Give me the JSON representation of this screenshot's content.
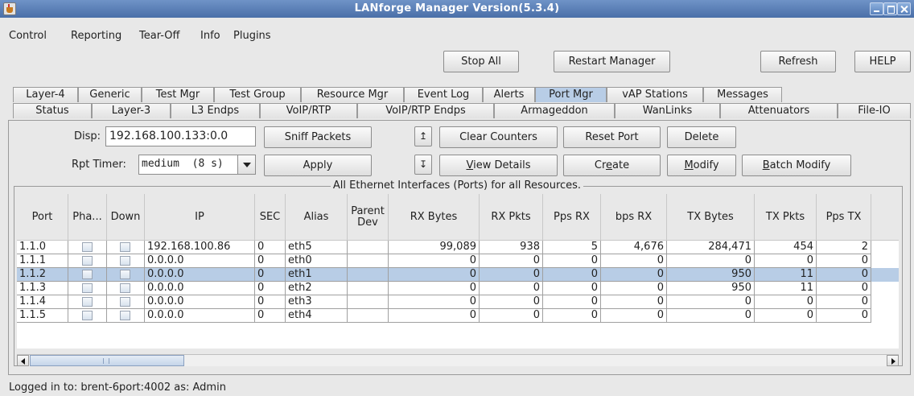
{
  "window": {
    "title": "LANforge Manager   Version(5.3.4)"
  },
  "menu": [
    "Control",
    "Reporting",
    "Tear-Off",
    "Info",
    "Plugins"
  ],
  "toolbar": {
    "stop_all": "Stop All",
    "restart_manager": "Restart Manager",
    "refresh": "Refresh",
    "help": "HELP"
  },
  "tabs_row1": [
    "Layer-4",
    "Generic",
    "Test Mgr",
    "Test Group",
    "Resource Mgr",
    "Event Log",
    "Alerts",
    "Port Mgr",
    "vAP Stations",
    "Messages"
  ],
  "tabs_row2": [
    "Status",
    "Layer-3",
    "L3 Endps",
    "VoIP/RTP",
    "VoIP/RTP Endps",
    "Armageddon",
    "WanLinks",
    "Attenuators",
    "File-IO"
  ],
  "active_tab": "Port Mgr",
  "controls": {
    "disp_label": "Disp:",
    "disp_value": "192.168.100.133:0.0",
    "rpt_label": "Rpt Timer:",
    "rpt_value": "medium  (8 s)",
    "sniff_packets": "Sniff Packets",
    "apply": "Apply",
    "sort_up": "↥",
    "sort_down": "↧",
    "clear_counters": "Clear Counters",
    "view_details": "View Details",
    "reset_port": "Reset Port",
    "create": "Create",
    "delete": "Delete",
    "modify": "Modify",
    "batch_modify": "Batch Modify"
  },
  "table": {
    "title": "All Ethernet Interfaces (Ports) for all Resources.",
    "columns": [
      "Port",
      "Pha...",
      "Down",
      "IP",
      "SEC",
      "Alias",
      "Parent Dev",
      "RX Bytes",
      "RX Pkts",
      "Pps RX",
      "bps RX",
      "TX Bytes",
      "TX Pkts",
      "Pps TX"
    ],
    "rows": [
      {
        "port": "1.1.0",
        "ip": "192.168.100.86",
        "sec": "0",
        "alias": "eth5",
        "rx_bytes": "99,089",
        "rx_pkts": "938",
        "pps_rx": "5",
        "bps_rx": "4,676",
        "tx_bytes": "284,471",
        "tx_pkts": "454",
        "pps_tx": "2",
        "selected": false
      },
      {
        "port": "1.1.1",
        "ip": "0.0.0.0",
        "sec": "0",
        "alias": "eth0",
        "rx_bytes": "0",
        "rx_pkts": "0",
        "pps_rx": "0",
        "bps_rx": "0",
        "tx_bytes": "0",
        "tx_pkts": "0",
        "pps_tx": "0",
        "selected": false
      },
      {
        "port": "1.1.2",
        "ip": "0.0.0.0",
        "sec": "0",
        "alias": "eth1",
        "rx_bytes": "0",
        "rx_pkts": "0",
        "pps_rx": "0",
        "bps_rx": "0",
        "tx_bytes": "950",
        "tx_pkts": "11",
        "pps_tx": "0",
        "selected": true
      },
      {
        "port": "1.1.3",
        "ip": "0.0.0.0",
        "sec": "0",
        "alias": "eth2",
        "rx_bytes": "0",
        "rx_pkts": "0",
        "pps_rx": "0",
        "bps_rx": "0",
        "tx_bytes": "950",
        "tx_pkts": "11",
        "pps_tx": "0",
        "selected": false
      },
      {
        "port": "1.1.4",
        "ip": "0.0.0.0",
        "sec": "0",
        "alias": "eth3",
        "rx_bytes": "0",
        "rx_pkts": "0",
        "pps_rx": "0",
        "bps_rx": "0",
        "tx_bytes": "0",
        "tx_pkts": "0",
        "pps_tx": "0",
        "selected": false
      },
      {
        "port": "1.1.5",
        "ip": "0.0.0.0",
        "sec": "0",
        "alias": "eth4",
        "rx_bytes": "0",
        "rx_pkts": "0",
        "pps_rx": "0",
        "bps_rx": "0",
        "tx_bytes": "0",
        "tx_pkts": "0",
        "pps_tx": "0",
        "selected": false
      }
    ]
  },
  "status": {
    "text": "Logged in to:  brent-6port:4002  as:  Admin"
  }
}
